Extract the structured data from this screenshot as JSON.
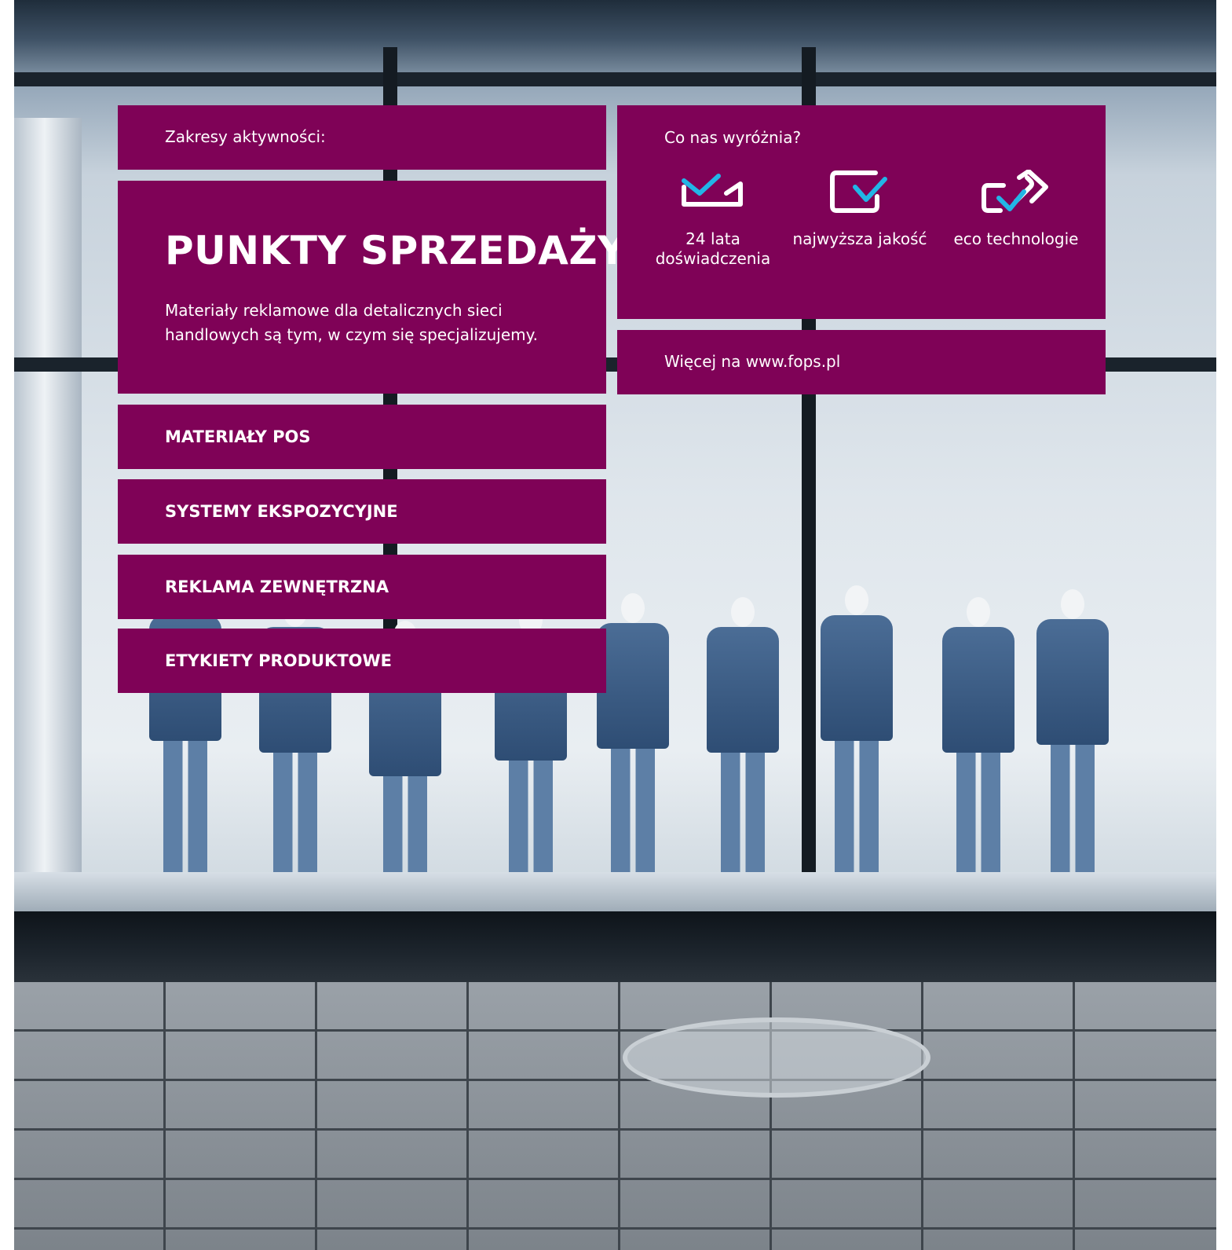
{
  "colors": {
    "panel": "#7f0257",
    "text": "#ffffff",
    "icon_accent": "#22b5e6"
  },
  "scope": {
    "heading": "Zakresy aktywności:",
    "title": "PUNKTY SPRZEDAŻY",
    "description": "Materiały reklamowe dla detalicznych sieci handlowych są tym, w czym się specjalizujemy.",
    "categories": [
      "MATERIAŁY POS",
      "SYSTEMY EKSPOZYCYJNE",
      "REKLAMA ZEWNĘTRZNA",
      "ETYKIETY PRODUKTOWE"
    ]
  },
  "highlights": {
    "heading": "Co nas wyróżnia?",
    "features": [
      {
        "icon": "crown-check-icon",
        "label": "24 lata doświadczenia"
      },
      {
        "icon": "box-check-icon",
        "label": "najwyższa jakość"
      },
      {
        "icon": "eco-link-check-icon",
        "label": "eco technologie"
      }
    ]
  },
  "more": {
    "text": "Więcej na www.fops.pl"
  }
}
